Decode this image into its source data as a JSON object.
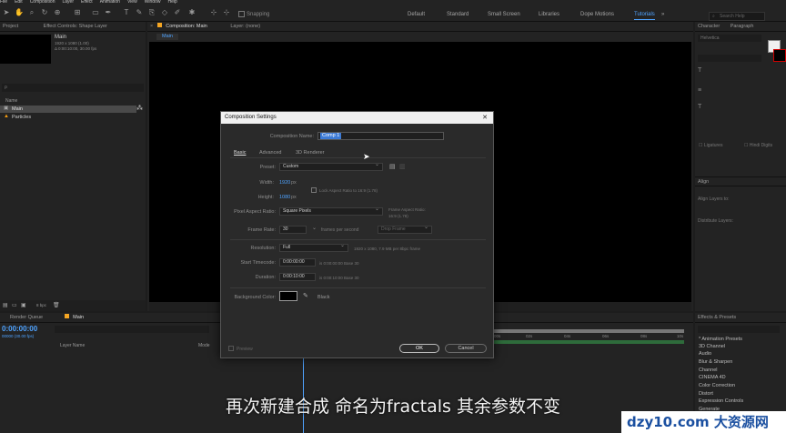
{
  "menu": [
    "File",
    "Edit",
    "Composition",
    "Layer",
    "Effect",
    "Animation",
    "View",
    "Window",
    "Help"
  ],
  "toolbar": {
    "snapping": "Snapping",
    "workspaces": [
      "Default",
      "Standard",
      "Small Screen",
      "Libraries",
      "Dope Motions",
      "Tutorials"
    ],
    "active_workspace": "Tutorials",
    "search_placeholder": "Search Help"
  },
  "project_panel": {
    "tab_project": "Project",
    "tab_effect_controls": "Effect Controls: Shape Layer",
    "comp_name": "Main",
    "comp_info1": "1920 x 1080 (1.00)",
    "comp_info2": "Δ 0:00:10:00, 30.00 fps",
    "search_placeholder": "ρ",
    "col_name": "Name",
    "items": [
      "Main",
      "Particles"
    ],
    "bpc": "8 bpc"
  },
  "viewer": {
    "tab_label": "Composition: Main",
    "layer_tab": "Layer: (none)",
    "breadcrumb": "Main"
  },
  "dialog": {
    "title": "Composition Settings",
    "name_label": "Composition Name:",
    "name_value": "Comp 1",
    "tabs": [
      "Basic",
      "Advanced",
      "3D Renderer"
    ],
    "preset_label": "Preset:",
    "preset_value": "Custom",
    "width_label": "Width:",
    "width_value": "1920",
    "height_label": "Height:",
    "height_value": "1080",
    "px": "px",
    "lock_label": "Lock Aspect Ratio to 16:9 (1.78)",
    "par_label": "Pixel Aspect Ratio:",
    "par_value": "Square Pixels",
    "frame_aspect_label": "Frame Aspect Ratio:",
    "frame_aspect_value": "16:9 (1.78)",
    "frame_rate_label": "Frame Rate:",
    "frame_rate_value": "30",
    "fps_label": "frames per second",
    "drop_frame": "Drop Frame",
    "resolution_label": "Resolution:",
    "resolution_value": "Full",
    "resolution_note": "1920 x 1080, 7.9 MB per 8bpc frame",
    "start_tc_label": "Start Timecode:",
    "start_tc_value": "0:00:00:00",
    "start_tc_note": "is 0:00:00:00  Base 30",
    "duration_label": "Duration:",
    "duration_value": "0:00:10:00",
    "duration_note": "is 0:00:10:00  Base 30",
    "bg_label": "Background Color:",
    "bg_name": "Black",
    "preview_label": "Preview",
    "ok": "OK",
    "cancel": "Cancel"
  },
  "timeline": {
    "tab_render": "Render Queue",
    "tab_main": "Main",
    "timecode": "0:00:00:00",
    "timecode_sub": "00000 (30.00 fps)",
    "col_layer_name": "Layer Name",
    "col_mode": "Mode",
    "ruler": [
      "00s",
      "02s",
      "04s",
      "06s",
      "08s",
      "10s"
    ]
  },
  "right_panel": {
    "character_tab": "Character",
    "paragraph_tab": "Paragraph",
    "font_label": "Helvetica",
    "align_label": "Align",
    "align_layers_to": "Align Layers to:",
    "distribute": "Distribute Layers:",
    "effects_title": "Effects & Presets",
    "effects": [
      "* Animation Presets",
      "3D Channel",
      "Audio",
      "Blur & Sharpen",
      "Channel",
      "CINEMA 4D",
      "Color Correction",
      "Distort",
      "Expression Controls",
      "Generate"
    ]
  },
  "subtitle": "再次新建合成 命名为fractals 其余参数不变",
  "watermark": "dzy10.com 大资源网",
  "colors": {
    "accent": "#4fa3ff",
    "panel": "#232323",
    "dialog": "#2a2a2a",
    "selection": "#3d7bd6"
  }
}
